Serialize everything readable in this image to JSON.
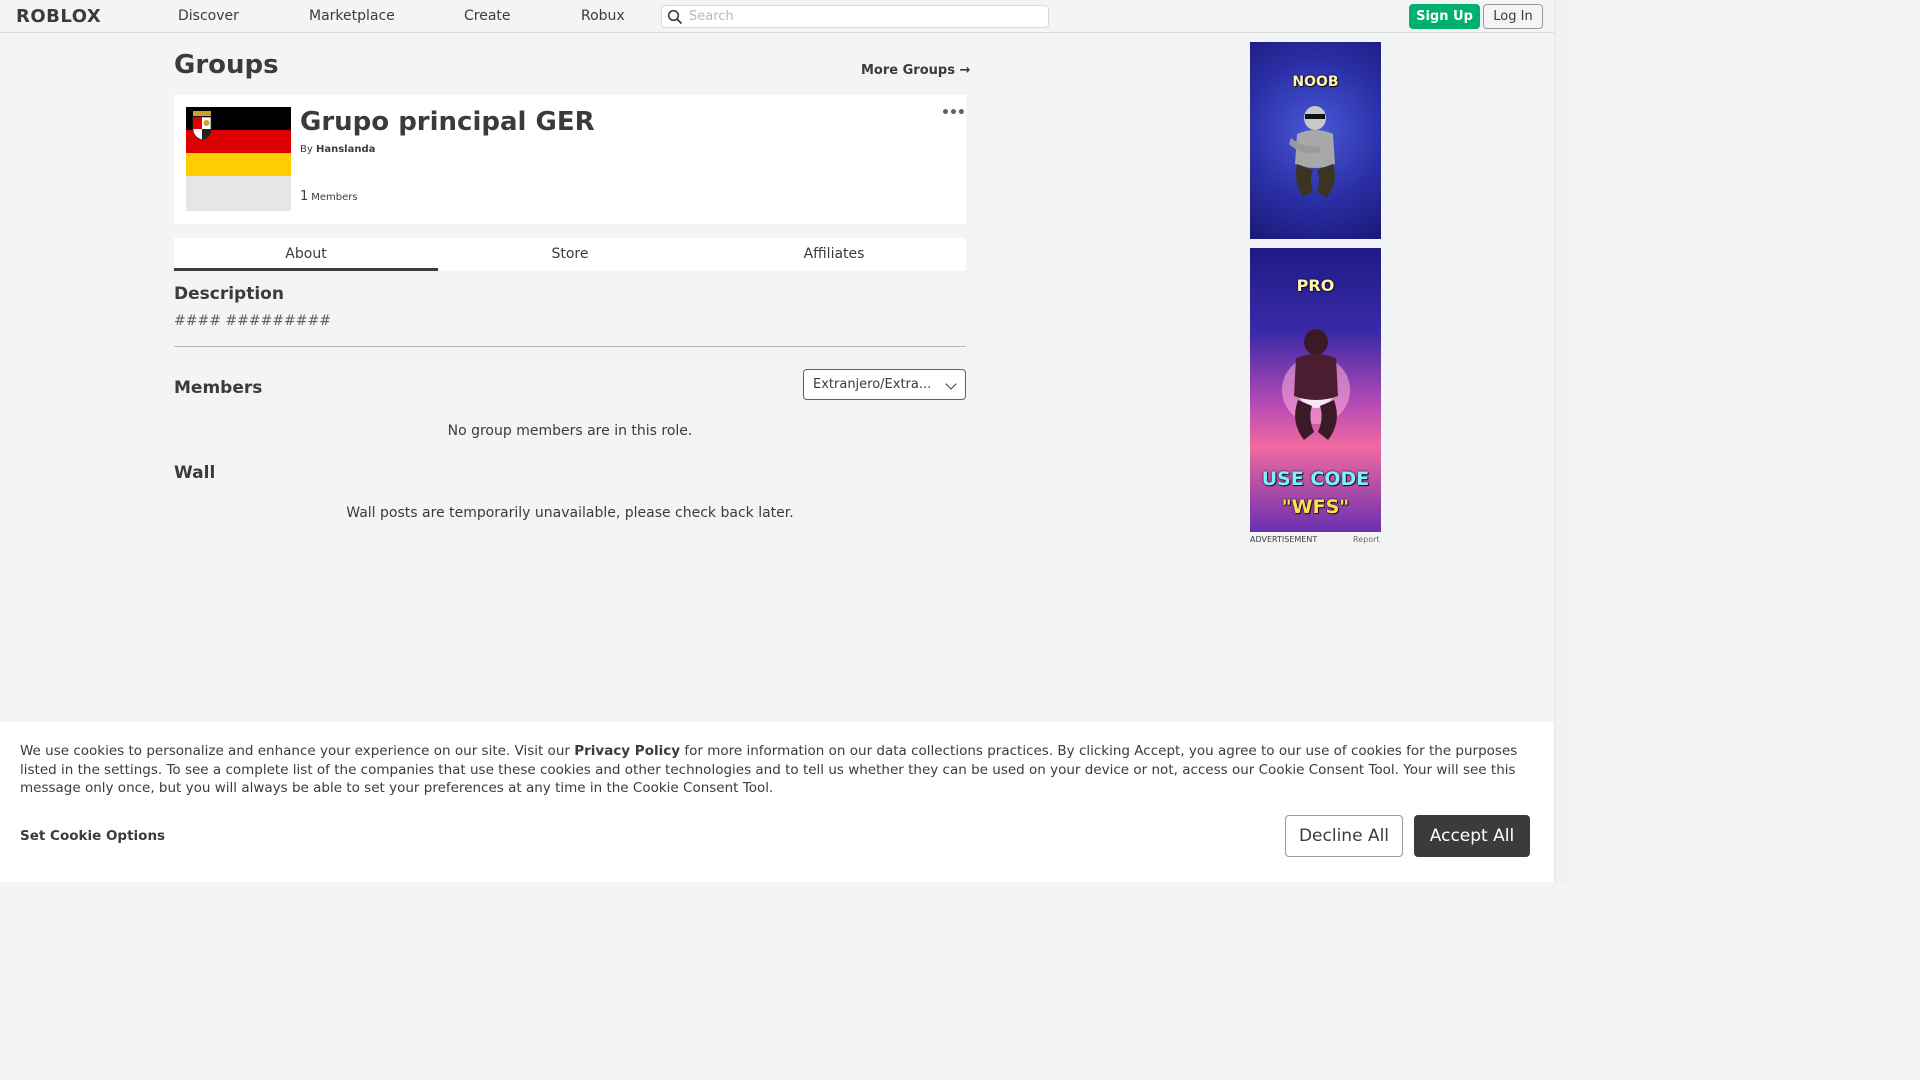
{
  "nav": {
    "logo": "ROBLOX",
    "links": [
      "Discover",
      "Marketplace",
      "Create",
      "Robux"
    ],
    "search_placeholder": "Search",
    "signup_label": "Sign Up",
    "login_label": "Log In"
  },
  "page": {
    "title": "Groups",
    "more_groups": "More Groups →"
  },
  "group": {
    "name": "Grupo principal GER",
    "by_label": "By",
    "owner": "Hanslanda",
    "member_count": "1",
    "members_label": "Members",
    "menu_glyph": "•••",
    "emblem_colors": [
      "#000000",
      "#dd0000",
      "#ffce00"
    ]
  },
  "tabs": [
    {
      "label": "About",
      "active": true
    },
    {
      "label": "Store",
      "active": false
    },
    {
      "label": "Affiliates",
      "active": false
    }
  ],
  "about": {
    "description_title": "Description",
    "description_text": "#### #########",
    "members_title": "Members",
    "role_selected": "Extranjero/Extra...",
    "members_empty": "No group members are in this role.",
    "wall_title": "Wall",
    "wall_msg": "Wall posts are temporarily unavailable, please check back later."
  },
  "ads": {
    "ad1_word": "NOOB",
    "ad2_word": "PRO",
    "ad2_code_line1": "USE CODE",
    "ad2_code_line2": "\"WFS\"",
    "label": "ADVERTISEMENT",
    "report": "Report"
  },
  "cookie": {
    "text_before": "We use cookies to personalize and enhance your experience on our site. Visit our ",
    "privacy_link": "Privacy Policy",
    "text_after": " for more information on our data collections practices. By clicking Accept, you agree to our use of cookies for the purposes listed in the settings. To see a complete list of the companies that use these cookies and other technologies and to tell us whether they can be used on your device or not, access our Cookie Consent Tool. Your will see this message only once, but you will always be able to set your preferences at any time in the Cookie Consent Tool.",
    "set_options": "Set Cookie Options",
    "decline": "Decline All",
    "accept": "Accept All"
  },
  "colors": {
    "accent_green": "#00b06f",
    "text_dark": "#393b3d",
    "page_bg": "#f2f4f5"
  }
}
